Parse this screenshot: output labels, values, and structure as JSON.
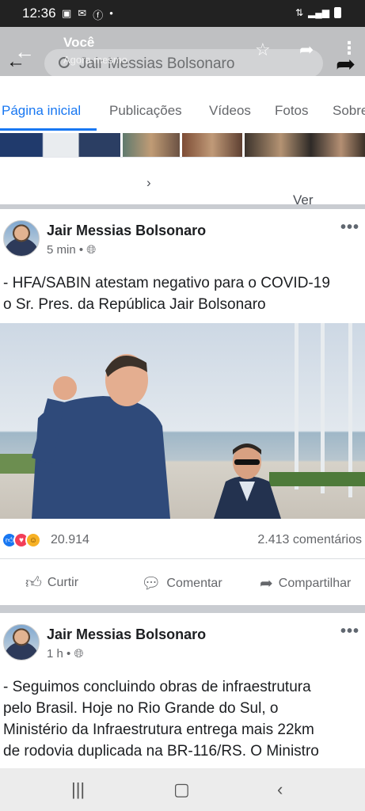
{
  "status_bar": {
    "time": "12:36",
    "battery": "88%"
  },
  "header": {
    "title": "Você",
    "subtitle": "Agora mesmo",
    "search_text": "Jair Messias Bolsonaro"
  },
  "tabs": [
    {
      "label": "Página inicial",
      "active": true
    },
    {
      "label": "Publicações"
    },
    {
      "label": "Vídeos"
    },
    {
      "label": "Fotos"
    },
    {
      "label": "Sobre"
    }
  ],
  "see_all": "Ver tudo",
  "posts": [
    {
      "author": "Jair Messias Bolsonaro",
      "time": "5 min",
      "text_lines": [
        "- HFA/SABIN atestam negativo para o COVID-19",
        "o Sr. Pres. da República Jair Bolsonaro"
      ],
      "reactions_count": "20.914",
      "comments_count": "2.413 comentários",
      "actions": {
        "like": "Curtir",
        "comment": "Comentar",
        "share": "Compartilhar"
      }
    },
    {
      "author": "Jair Messias Bolsonaro",
      "time": "1 h",
      "text_lines": [
        "- Seguimos concluindo obras de infraestrutura",
        "pelo Brasil. Hoje no Rio Grande do Sul, o",
        "Ministério da Infraestrutura entrega mais 22km",
        "de rodovia duplicada na BR-116/RS. O Ministro"
      ]
    }
  ],
  "colors": {
    "accent": "#1877f2",
    "like": "#1877f2",
    "love": "#f33e58",
    "haha": "#f7b125"
  }
}
